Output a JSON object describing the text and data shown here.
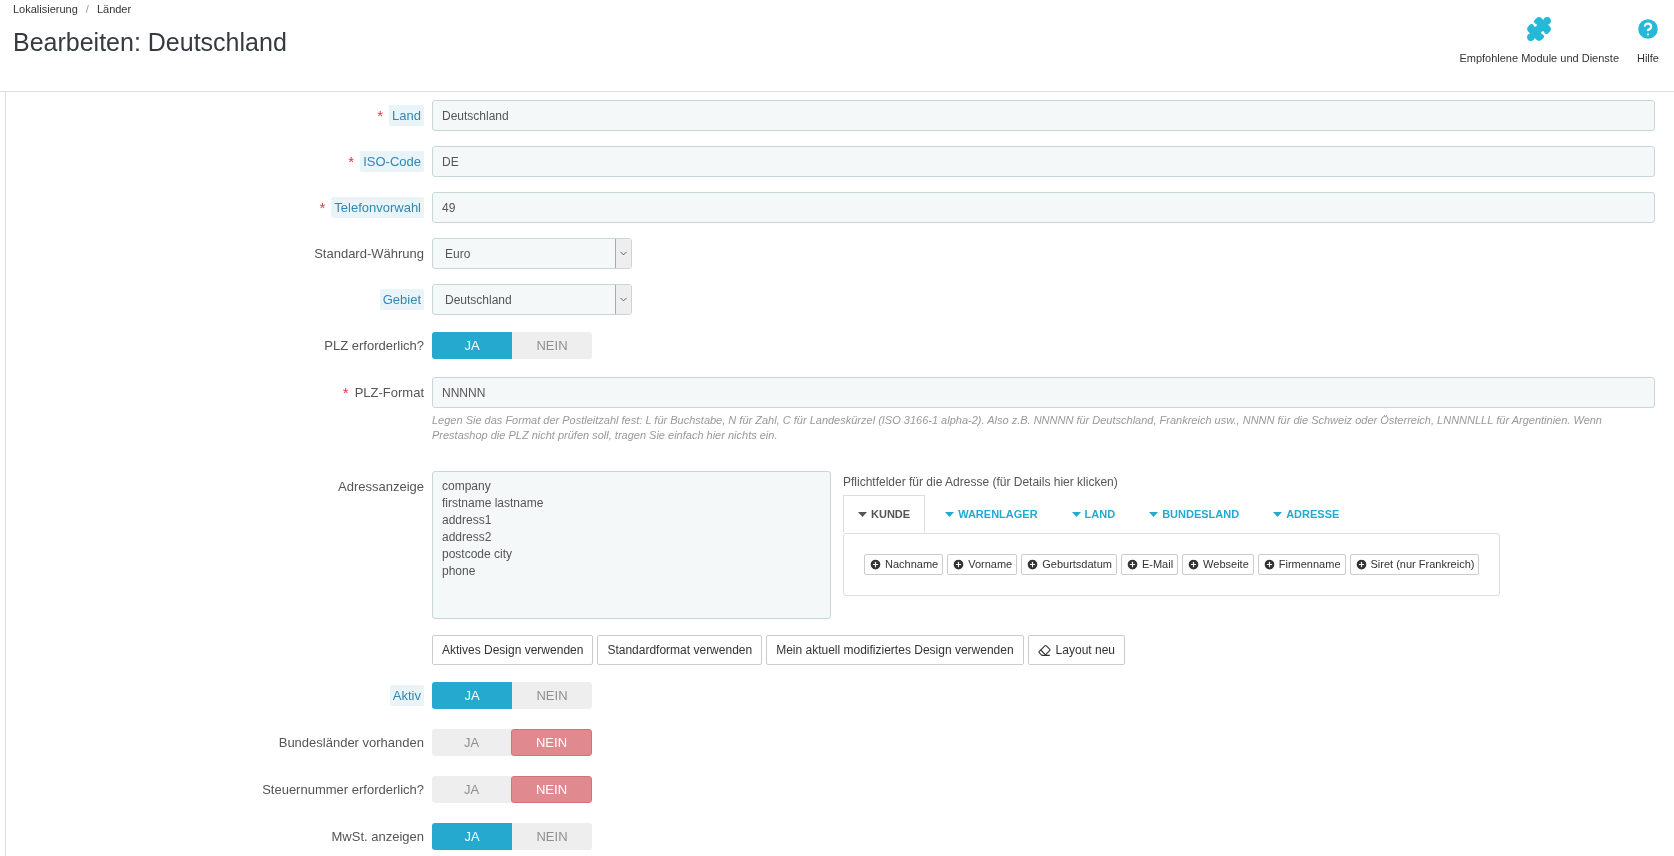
{
  "breadcrumb": [
    "Lokalisierung",
    "Länder"
  ],
  "breadcrumb_separator": "/",
  "page_title": "Bearbeiten: Deutschland",
  "toolbar": [
    {
      "kind": "modules",
      "label": "Empfohlene Module und Dienste"
    },
    {
      "kind": "help",
      "label": "Hilfe"
    }
  ],
  "fields": [
    {
      "kind": "text",
      "label": "Land",
      "required_mark": "*",
      "hint": true,
      "value": "Deutschland"
    },
    {
      "kind": "text",
      "label": "ISO-Code",
      "required_mark": "*",
      "hint": true,
      "value": "DE"
    },
    {
      "kind": "text",
      "label": "Telefonvorwahl",
      "required_mark": "*",
      "hint": true,
      "value": "49"
    },
    {
      "kind": "select",
      "label": "Standard-Währung",
      "hint": false,
      "value": "Euro"
    },
    {
      "kind": "select",
      "label": "Gebiet",
      "hint": true,
      "value": "Deutschland"
    },
    {
      "kind": "switch",
      "label": "PLZ erforderlich?",
      "hint": false,
      "yes": "JA",
      "no": "NEIN",
      "on": true
    },
    {
      "kind": "text",
      "label": "PLZ-Format",
      "required_mark": "*",
      "hint": false,
      "value": "NNNNN",
      "help": "Legen Sie das Format der Postleitzahl fest: L für Buchstabe, N für Zahl, C für Landeskürzel (ISO 3166-1 alpha-2). Also z.B. NNNNN für Deutschland, Frankreich usw., NNNN für die Schweiz oder Österreich, LNNNNLLL für Argentinien. Wenn Prestashop die PLZ nicht prüfen soll, tragen Sie einfach hier nichts ein."
    },
    {
      "kind": "address",
      "label": "Adressanzeige",
      "hint": false,
      "lines": [
        "company",
        "firstname lastname",
        "address1",
        "address2",
        "postcode city",
        "phone"
      ],
      "required_heading": "Pflichtfelder für die Adresse (für Details hier klicken)",
      "tabs": [
        {
          "label": "KUNDE",
          "selected": true
        },
        {
          "label": "WARENLAGER",
          "selected": false
        },
        {
          "label": "LAND",
          "selected": false
        },
        {
          "label": "BUNDESLAND",
          "selected": false
        },
        {
          "label": "ADRESSE",
          "selected": false
        }
      ],
      "chips": [
        "Nachname",
        "Vorname",
        "Geburtsdatum",
        "E-Mail",
        "Webseite",
        "Firmenname",
        "Siret (nur Frankreich)"
      ],
      "buttons": [
        {
          "kind": "plain",
          "label": "Aktives Design verwenden"
        },
        {
          "kind": "plain",
          "label": "Standardformat verwenden"
        },
        {
          "kind": "plain",
          "label": "Mein aktuell modifiziertes Design verwenden"
        },
        {
          "kind": "eraser",
          "label": "Layout neu"
        }
      ]
    },
    {
      "kind": "switch",
      "label": "Aktiv",
      "hint": true,
      "yes": "JA",
      "no": "NEIN",
      "on": true
    },
    {
      "kind": "switch",
      "label": "Bundesländer vorhanden",
      "hint": false,
      "yes": "JA",
      "no": "NEIN",
      "on": false
    },
    {
      "kind": "switch",
      "label": "Steuernummer erforderlich?",
      "hint": false,
      "yes": "JA",
      "no": "NEIN",
      "on": false
    },
    {
      "kind": "switch",
      "label": "MwSt. anzeigen",
      "hint": false,
      "yes": "JA",
      "no": "NEIN",
      "on": true
    }
  ]
}
